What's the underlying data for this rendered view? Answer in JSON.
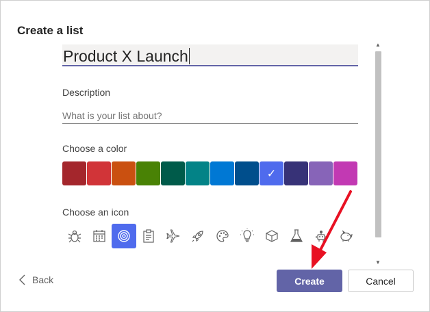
{
  "dialog": {
    "title": "Create a list",
    "name_value": "Product X Launch",
    "description_label": "Description",
    "description_placeholder": "What is your list about?",
    "color_label": "Choose a color",
    "icon_label": "Choose an icon",
    "colors": [
      "#a4262c",
      "#d13438",
      "#ca5010",
      "#498205",
      "#005b4a",
      "#038387",
      "#0078d4",
      "#004e8c",
      "#4f6bed",
      "#373277",
      "#8764b8",
      "#c239b3"
    ],
    "selected_color_index": 8,
    "check_glyph": "✓",
    "icons": [
      "bug-icon",
      "calendar-icon",
      "target-icon",
      "clipboard-icon",
      "airplane-icon",
      "rocket-icon",
      "palette-icon",
      "lightbulb-icon",
      "cube-icon",
      "flask-icon",
      "robot-icon",
      "piggy-bank-icon"
    ],
    "selected_icon": "target-icon"
  },
  "footer": {
    "back_label": "Back",
    "create_label": "Create",
    "cancel_label": "Cancel"
  },
  "annotation_color": "#e81123"
}
